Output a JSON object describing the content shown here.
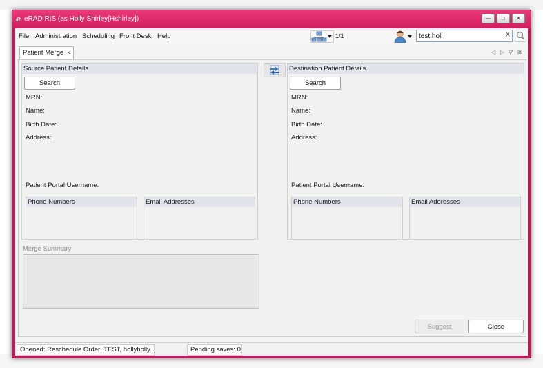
{
  "window": {
    "title": "eRAD RIS (as Holly Shirley[Hshirley])",
    "logo": "e",
    "minimize_icon": "minimize-icon",
    "maximize_icon": "maximize-icon",
    "close_icon": "close-icon"
  },
  "menubar": {
    "items": [
      "File",
      "Administration",
      "Scheduling",
      "Front Desk",
      "Help"
    ],
    "page_count": "1/1",
    "search_value": "test,holl",
    "search_clear": "X"
  },
  "tabs": [
    {
      "label": "Patient Merge",
      "close": "×"
    }
  ],
  "source": {
    "header": "Source Patient Details",
    "search_label": "Search",
    "mrn_label": "MRN:",
    "name_label": "Name:",
    "birth_label": "Birth Date:",
    "address_label": "Address:",
    "portal_label": "Patient Portal Username:",
    "phones_header": "Phone Numbers",
    "emails_header": "Email Addresses"
  },
  "destination": {
    "header": "Destination Patient Details",
    "search_label": "Search",
    "mrn_label": "MRN:",
    "name_label": "Name:",
    "birth_label": "Birth Date:",
    "address_label": "Address:",
    "portal_label": "Patient Portal Username:",
    "phones_header": "Phone Numbers",
    "emails_header": "Email Addresses"
  },
  "merge_summary": {
    "label": "Merge Summary"
  },
  "actions": {
    "suggest_label": "Suggest",
    "close_label": "Close"
  },
  "statusbar": {
    "opened": "Opened: Reschedule Order: TEST, hollyholly...",
    "pending": "Pending saves: 0"
  },
  "colors": {
    "titlebar": "#d81b60",
    "panel_header": "#e2e4ec"
  }
}
